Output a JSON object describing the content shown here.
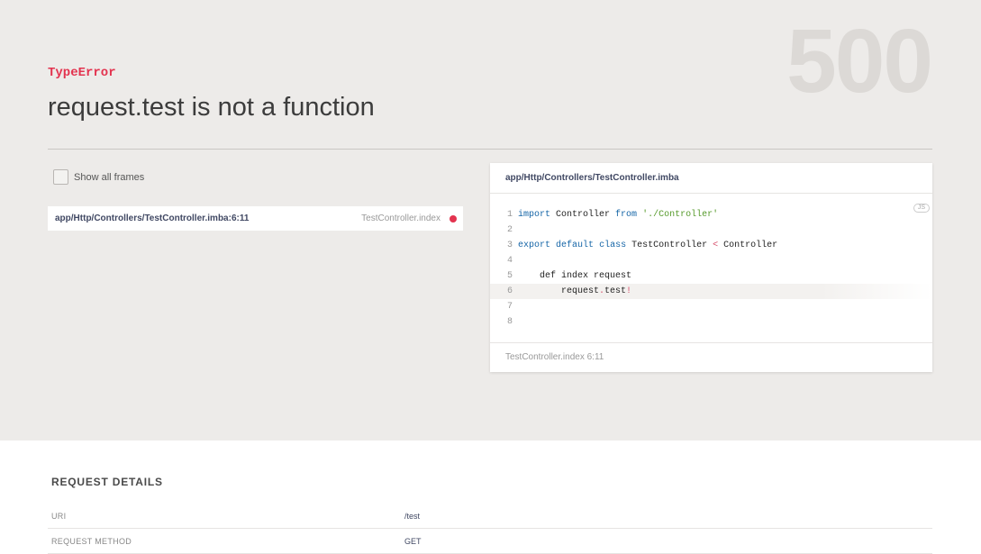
{
  "error": {
    "status_code": "500",
    "type": "TypeError",
    "message": "request.test is not a function"
  },
  "frames_toggle": {
    "label": "Show all frames",
    "checked": false
  },
  "frames": [
    {
      "file": "app/Http/Controllers/TestController.imba:6:11",
      "method": "TestController.index"
    }
  ],
  "code_panel": {
    "file": "app/Http/Controllers/TestController.imba",
    "lang_badge": "JS",
    "footer": "TestController.index 6:11",
    "highlight_line": 6,
    "lines": [
      {
        "n": "1"
      },
      {
        "n": "2"
      },
      {
        "n": "3"
      },
      {
        "n": "4"
      },
      {
        "n": "5"
      },
      {
        "n": "6"
      },
      {
        "n": "7"
      },
      {
        "n": "8"
      }
    ],
    "tokens": {
      "l1_import": "import",
      "l1_name": " Controller ",
      "l1_from": "from",
      "l1_sp": " ",
      "l1_path": "'./Controller'",
      "l3_export": "export",
      "l3_sp1": " ",
      "l3_default": "default",
      "l3_sp2": " ",
      "l3_class": "class",
      "l3_name": " TestController ",
      "l3_lt": "<",
      "l3_parent": " Controller",
      "l5_code": "    def index request",
      "l6_req": "        request",
      "l6_dot": ".",
      "l6_test": "test",
      "l6_bang": "!"
    }
  },
  "request_details": {
    "title": "REQUEST DETAILS",
    "rows": [
      {
        "key": "URI",
        "value": "/test"
      },
      {
        "key": "REQUEST METHOD",
        "value": "GET"
      }
    ]
  },
  "colors": {
    "accent": "#e3334f",
    "header_bg": "#edebe9",
    "link": "#404863"
  }
}
